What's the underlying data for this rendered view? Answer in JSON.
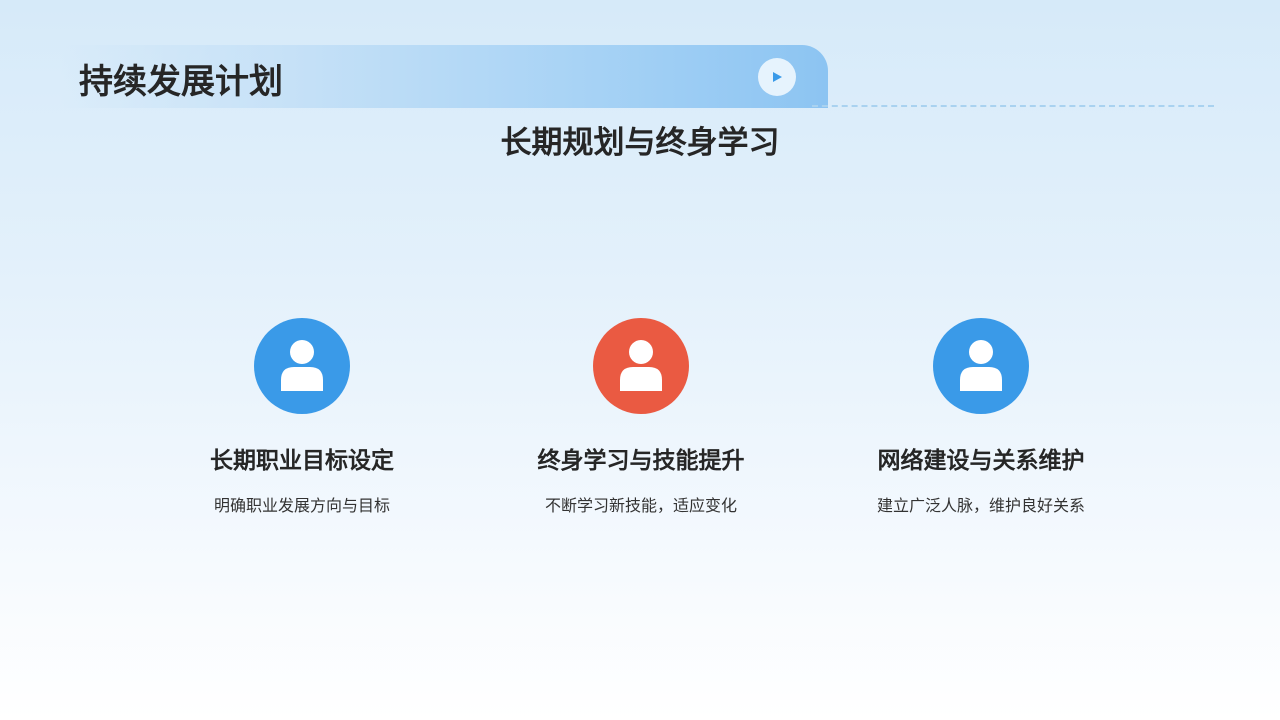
{
  "header": {
    "title": "持续发展计划"
  },
  "subtitle": "长期规划与终身学习",
  "colors": {
    "accent_blue": "#3a9ae8",
    "accent_red": "#ea5a42",
    "play_arrow": "#3a9ae8"
  },
  "cards": [
    {
      "icon": "user-icon",
      "color": "#3a9ae8",
      "title": "长期职业目标设定",
      "desc": "明确职业发展方向与目标"
    },
    {
      "icon": "user-icon",
      "color": "#ea5a42",
      "title": "终身学习与技能提升",
      "desc": "不断学习新技能，适应变化"
    },
    {
      "icon": "user-icon",
      "color": "#3a9ae8",
      "title": "网络建设与关系维护",
      "desc": "建立广泛人脉，维护良好关系"
    }
  ]
}
